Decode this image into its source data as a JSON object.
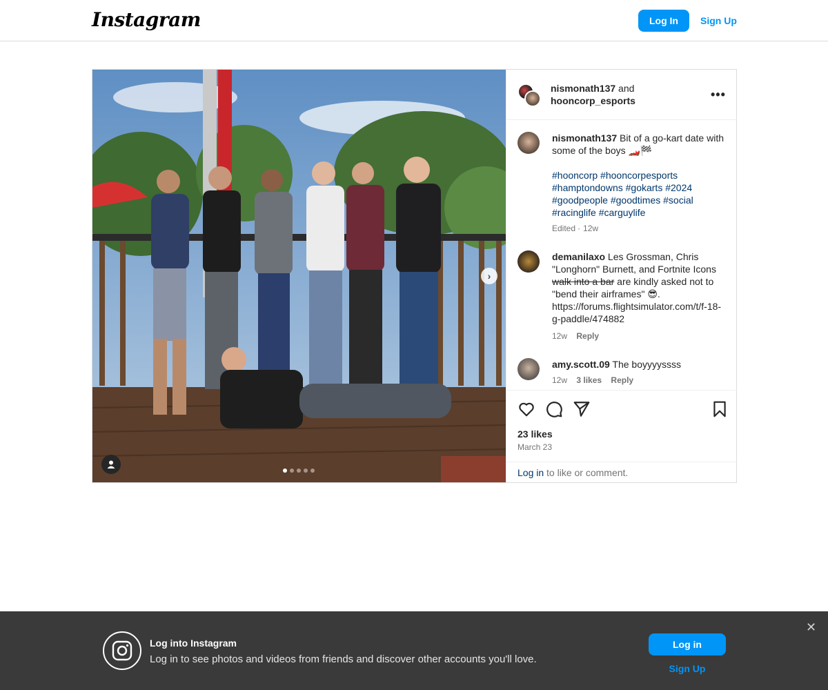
{
  "header": {
    "logo": "Instagram",
    "login_label": "Log In",
    "signup_label": "Sign Up"
  },
  "post": {
    "author_line": {
      "user1": "nismonath137",
      "connector": "and",
      "user2": "hooncorp_esports"
    },
    "more_icon": "more-horizontal-icon",
    "carousel": {
      "slide_count": 5,
      "active_slide": 1,
      "next_icon": "chevron-right-icon",
      "tag_icon": "user-tag-icon"
    },
    "caption": {
      "username": "nismonath137",
      "text": "Bit of a go-kart date with some of the boys 🏎️🏁",
      "hashtags": "#hooncorp #hooncorpesports #hamptondowns #gokarts #2024 #goodpeople #goodtimes #social #racinglife #carguylife",
      "edited": "Edited",
      "sep": "·",
      "age": "12w"
    },
    "comments": [
      {
        "username": "demanilaxo",
        "text_before": "Les Grossman, Chris \"Longhorn\" Burnett, and Fortnite Icons ",
        "struck": "walk into a bar",
        "text_after": " are kindly asked not to \"bend their airframes\" 😎. https://forums.flightsimulator.com/t/f-18-g-paddle/474882",
        "age": "12w",
        "reply": "Reply"
      },
      {
        "username": "amy.scott.09",
        "text": "The boyyyyssss",
        "age": "12w",
        "likes": "3 likes",
        "reply": "Reply"
      }
    ],
    "actions": {
      "like_icon": "heart-icon",
      "comment_icon": "comment-icon",
      "share_icon": "send-icon",
      "save_icon": "bookmark-icon"
    },
    "likes": "23 likes",
    "date": "March 23",
    "login_prompt": {
      "link": "Log in",
      "rest": "to like or comment."
    }
  },
  "banner": {
    "icon": "instagram-logo-icon",
    "title": "Log into Instagram",
    "subtitle": "Log in to see photos and videos from friends and discover other accounts you'll love.",
    "login_label": "Log in",
    "signup_label": "Sign Up",
    "close_icon": "close-icon"
  }
}
